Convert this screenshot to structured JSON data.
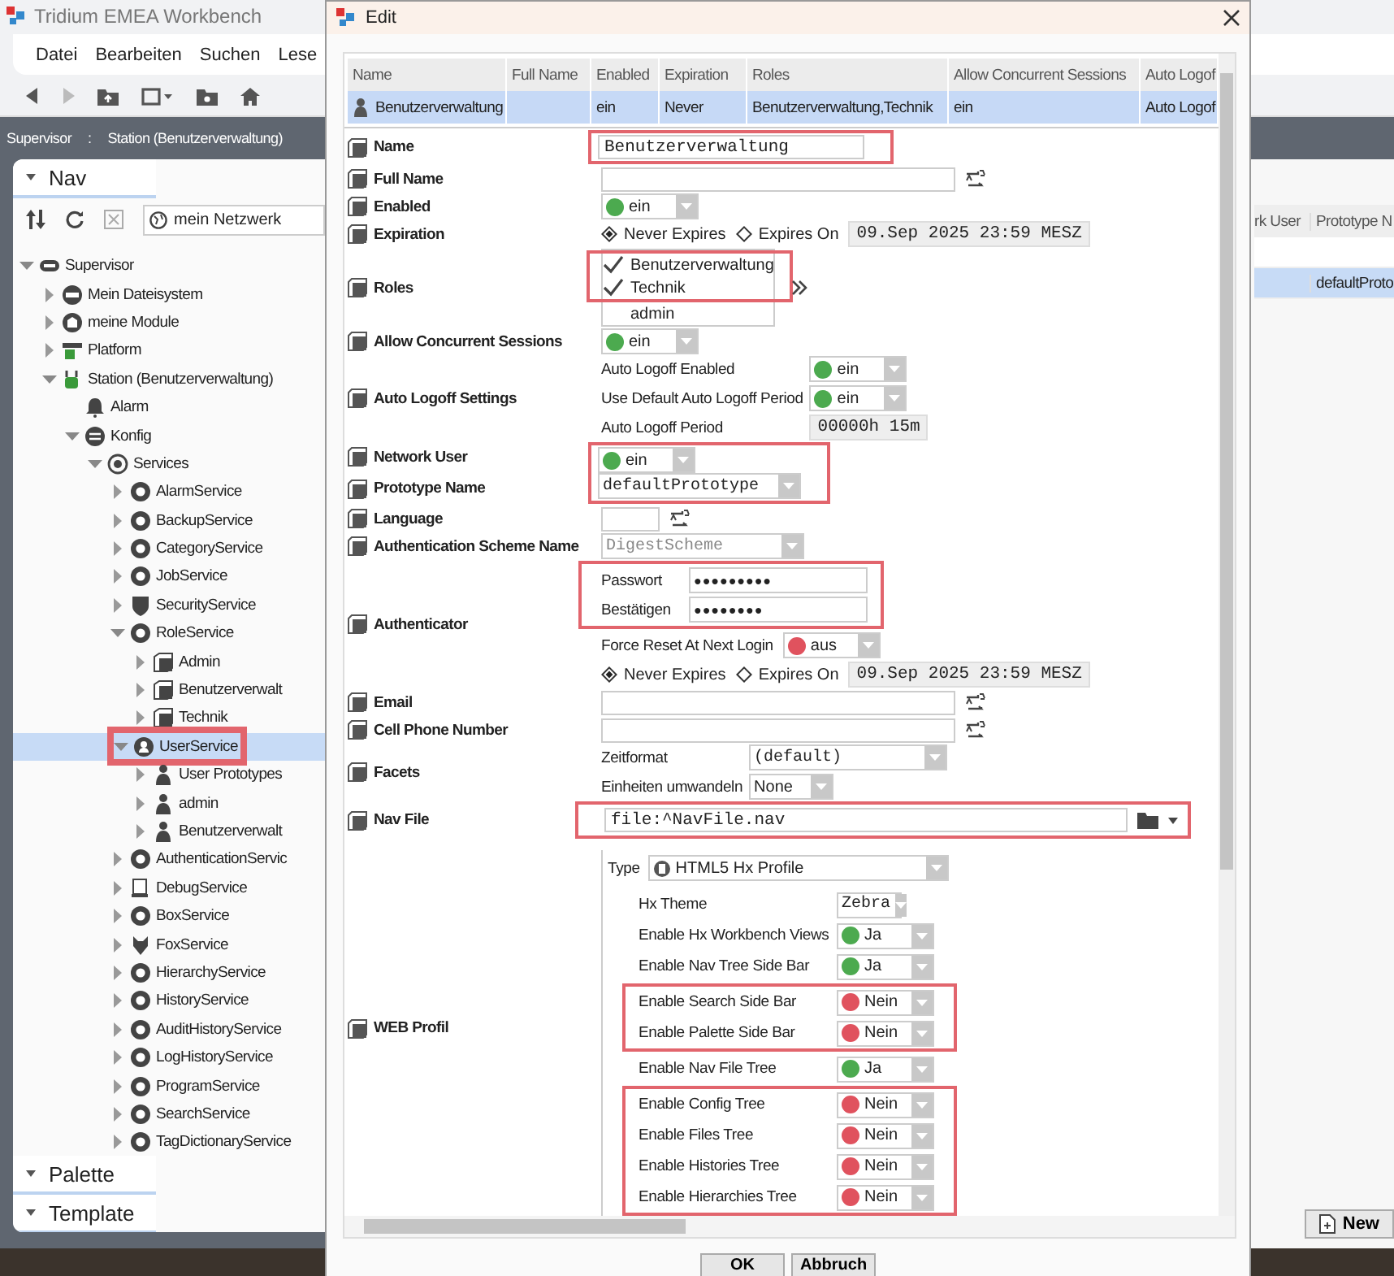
{
  "app": {
    "title": "Tridium EMEA Workbench",
    "menu": [
      "Datei",
      "Bearbeiten",
      "Suchen",
      "Lese"
    ]
  },
  "path": [
    "Supervisor",
    ":",
    "Station (Benutzerverwaltung)"
  ],
  "nav": {
    "title": "Nav",
    "search": "mein Netzwerk",
    "tree": [
      {
        "label": "Supervisor",
        "kind": "root",
        "expanded": true,
        "selected": false,
        "children": [
          {
            "label": "Mein Dateisystem",
            "kind": "drive",
            "expanded": false,
            "selected": false
          },
          {
            "label": "meine Module",
            "kind": "module",
            "expanded": false,
            "selected": false
          },
          {
            "label": "Platform",
            "kind": "platform",
            "expanded": false,
            "selected": false
          },
          {
            "label": "Station (Benutzerverwaltung)",
            "kind": "station",
            "expanded": true,
            "selected": false,
            "children": [
              {
                "label": "Alarm",
                "kind": "alarm",
                "selected": false
              },
              {
                "label": "Konfig",
                "kind": "config",
                "expanded": true,
                "selected": false,
                "children": [
                  {
                    "label": "Services",
                    "kind": "services",
                    "expanded": true,
                    "selected": false,
                    "children": [
                      {
                        "label": "AlarmService",
                        "kind": "service",
                        "expanded": false,
                        "selected": false
                      },
                      {
                        "label": "BackupService",
                        "kind": "service",
                        "expanded": false,
                        "selected": false
                      },
                      {
                        "label": "CategoryService",
                        "kind": "service",
                        "expanded": false,
                        "selected": false
                      },
                      {
                        "label": "JobService",
                        "kind": "service",
                        "expanded": false,
                        "selected": false
                      },
                      {
                        "label": "SecurityService",
                        "kind": "security",
                        "expanded": false,
                        "selected": false
                      },
                      {
                        "label": "RoleService",
                        "kind": "service",
                        "expanded": true,
                        "selected": false,
                        "children": [
                          {
                            "label": "Admin",
                            "kind": "role",
                            "expanded": false,
                            "selected": false
                          },
                          {
                            "label": "Benutzerverwalt",
                            "kind": "role",
                            "expanded": false,
                            "selected": false
                          },
                          {
                            "label": "Technik",
                            "kind": "role",
                            "expanded": false,
                            "selected": false
                          }
                        ]
                      },
                      {
                        "label": "UserService",
                        "kind": "userservice",
                        "expanded": true,
                        "selected": true,
                        "marked": true,
                        "children": [
                          {
                            "label": "User Prototypes",
                            "kind": "user",
                            "expanded": false,
                            "selected": false
                          },
                          {
                            "label": "admin",
                            "kind": "user",
                            "expanded": false,
                            "selected": false
                          },
                          {
                            "label": "Benutzerverwalt",
                            "kind": "user",
                            "expanded": false,
                            "selected": false
                          }
                        ]
                      },
                      {
                        "label": "AuthenticationServic",
                        "kind": "service",
                        "expanded": false,
                        "selected": false
                      },
                      {
                        "label": "DebugService",
                        "kind": "debug",
                        "expanded": false,
                        "selected": false
                      },
                      {
                        "label": "BoxService",
                        "kind": "service",
                        "expanded": false,
                        "selected": false
                      },
                      {
                        "label": "FoxService",
                        "kind": "fox",
                        "expanded": false,
                        "selected": false
                      },
                      {
                        "label": "HierarchyService",
                        "kind": "service",
                        "expanded": false,
                        "selected": false
                      },
                      {
                        "label": "HistoryService",
                        "kind": "service",
                        "expanded": false,
                        "selected": false
                      },
                      {
                        "label": "AuditHistoryService",
                        "kind": "service",
                        "expanded": false,
                        "selected": false
                      },
                      {
                        "label": "LogHistoryService",
                        "kind": "service",
                        "expanded": false,
                        "selected": false
                      },
                      {
                        "label": "ProgramService",
                        "kind": "service",
                        "expanded": false,
                        "selected": false
                      },
                      {
                        "label": "SearchService",
                        "kind": "service",
                        "expanded": false,
                        "selected": false
                      },
                      {
                        "label": "TagDictionaryService",
                        "kind": "service",
                        "expanded": false,
                        "selected": false
                      }
                    ]
                  }
                ]
              }
            ]
          }
        ]
      }
    ]
  },
  "side_panels": [
    "Palette",
    "Template"
  ],
  "background_table": {
    "columns": [
      "rk User",
      "Prototype N"
    ],
    "rows": [
      {
        "selected": false
      },
      {
        "selected": true,
        "prototype_name": "defaultProto"
      }
    ]
  },
  "new_button": "New",
  "dialog": {
    "title": "Edit",
    "table": {
      "columns": [
        "Name",
        "Full Name",
        "Enabled",
        "Expiration",
        "Roles",
        "Allow Concurrent Sessions",
        "Auto Logof"
      ],
      "rows": [
        {
          "selected": true,
          "cells": [
            "Benutzerverwaltung",
            null,
            "ein",
            "Never",
            "Benutzerverwaltung,Technik",
            "ein",
            "Auto Logof"
          ]
        }
      ]
    },
    "properties": [
      {
        "label": "Name",
        "kind": "text",
        "value": "Benutzerverwaltung",
        "marked": true
      },
      {
        "label": "Full Name",
        "kind": "text_ab",
        "marked": false
      },
      {
        "label": "Enabled",
        "kind": "toggle",
        "on": true,
        "value": "ein",
        "marked": false
      },
      {
        "label": "Expiration",
        "kind": "expiration",
        "marked": false,
        "options": [
          {
            "label": "Never Expires",
            "selected": true
          },
          {
            "label": "Expires On",
            "selected": false
          }
        ],
        "date": "09.Sep 2025 23:59 MESZ"
      },
      {
        "label": "Roles",
        "kind": "roles",
        "marked": false,
        "roles": [
          {
            "name": "Benutzerverwaltung",
            "checked": true,
            "marked": true
          },
          {
            "name": "Technik",
            "checked": true,
            "marked": true
          },
          {
            "name": "admin",
            "checked": false,
            "marked": false
          }
        ]
      },
      {
        "label": "Allow Concurrent Sessions",
        "kind": "toggle",
        "on": true,
        "value": "ein",
        "marked": false
      },
      {
        "label": "Auto Logoff Settings",
        "kind": "group",
        "marked": false,
        "items": [
          {
            "label": "Auto Logoff Enabled",
            "kind": "toggle",
            "on": true,
            "value": "ein"
          },
          {
            "label": "Use Default Auto Logoff Period",
            "kind": "toggle",
            "on": true,
            "value": "ein"
          },
          {
            "label": "Auto Logoff Period",
            "kind": "duration",
            "value": "00000h 15m"
          }
        ]
      },
      {
        "label": "Network User",
        "kind": "toggle",
        "on": true,
        "value": "ein",
        "marked": true
      },
      {
        "label": "Prototype Name",
        "kind": "dropdown",
        "value": "defaultPrototype",
        "disabled": false,
        "marked": true
      },
      {
        "label": "Language",
        "kind": "short_text_ab",
        "marked": false
      },
      {
        "label": "Authentication Scheme Name",
        "kind": "dropdown",
        "value": "DigestScheme",
        "disabled": true,
        "marked": false
      },
      {
        "label": "Authenticator",
        "kind": "authenticator",
        "marked": false,
        "passwords": {
          "marked": true,
          "fields": [
            {
              "label": "Passwort",
              "value": "●●●●●●●●●"
            },
            {
              "label": "Bestätigen",
              "value": "●●●●●●●●"
            }
          ]
        },
        "force_reset": {
          "label": "Force Reset At Next Login",
          "on": false,
          "value": "aus"
        },
        "options": [
          {
            "label": "Never Expires",
            "selected": true
          },
          {
            "label": "Expires On",
            "selected": false
          }
        ],
        "date": "09.Sep 2025 23:59 MESZ"
      },
      {
        "label": "Email",
        "kind": "text_ab",
        "marked": false
      },
      {
        "label": "Cell Phone Number",
        "kind": "text_ab",
        "marked": false
      },
      {
        "label": "Facets",
        "kind": "facets",
        "marked": false,
        "items": [
          {
            "label": "Zeitformat",
            "value": "(default)"
          },
          {
            "label": "Einheiten umwandeln",
            "value": "None"
          }
        ]
      },
      {
        "label": "Nav File",
        "kind": "file",
        "value": "file:^NavFile.nav",
        "marked": true
      },
      {
        "label": "WEB Profil",
        "kind": "web_profile",
        "marked": false,
        "type_label": "Type",
        "type_value": "HTML5 Hx Profile",
        "rows": [
          {
            "label": "Hx Theme",
            "kind": "dropdown",
            "value": "Zebra",
            "marked": false
          },
          {
            "label": "Enable Hx Workbench Views",
            "kind": "toggle",
            "on": true,
            "value": "Ja",
            "marked": false
          },
          {
            "label": "Enable Nav Tree Side Bar",
            "kind": "toggle",
            "on": true,
            "value": "Ja",
            "marked": false
          },
          {
            "label": "Enable Search Side Bar",
            "kind": "toggle",
            "on": false,
            "value": "Nein",
            "marked": true
          },
          {
            "label": "Enable Palette Side Bar",
            "kind": "toggle",
            "on": false,
            "value": "Nein",
            "marked": true
          },
          {
            "label": "Enable Nav File Tree",
            "kind": "toggle",
            "on": true,
            "value": "Ja",
            "marked": false
          },
          {
            "label": "Enable Config Tree",
            "kind": "toggle",
            "on": false,
            "value": "Nein",
            "marked": true
          },
          {
            "label": "Enable Files Tree",
            "kind": "toggle",
            "on": false,
            "value": "Nein",
            "marked": true
          },
          {
            "label": "Enable Histories Tree",
            "kind": "toggle",
            "on": false,
            "value": "Nein",
            "marked": true
          },
          {
            "label": "Enable Hierarchies Tree",
            "kind": "toggle",
            "on": false,
            "value": "Nein",
            "marked": true
          }
        ]
      }
    ],
    "buttons": [
      "OK",
      "Abbruch"
    ]
  }
}
